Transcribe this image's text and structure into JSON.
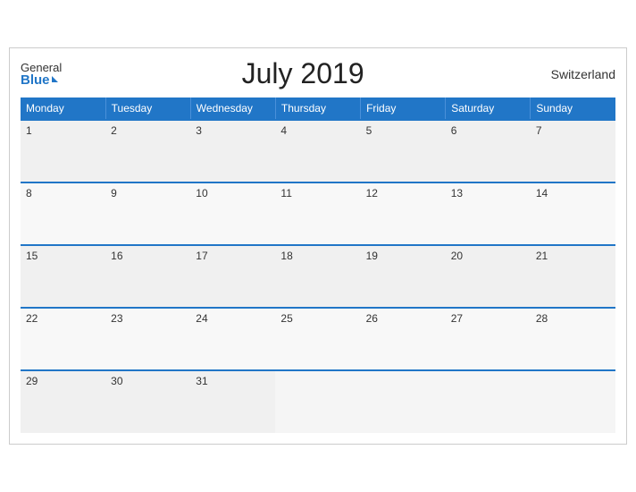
{
  "header": {
    "logo_general": "General",
    "logo_blue": "Blue",
    "title": "July 2019",
    "country": "Switzerland"
  },
  "days_of_week": [
    "Monday",
    "Tuesday",
    "Wednesday",
    "Thursday",
    "Friday",
    "Saturday",
    "Sunday"
  ],
  "weeks": [
    [
      "1",
      "2",
      "3",
      "4",
      "5",
      "6",
      "7"
    ],
    [
      "8",
      "9",
      "10",
      "11",
      "12",
      "13",
      "14"
    ],
    [
      "15",
      "16",
      "17",
      "18",
      "19",
      "20",
      "21"
    ],
    [
      "22",
      "23",
      "24",
      "25",
      "26",
      "27",
      "28"
    ],
    [
      "29",
      "30",
      "31",
      "",
      "",
      "",
      ""
    ]
  ]
}
